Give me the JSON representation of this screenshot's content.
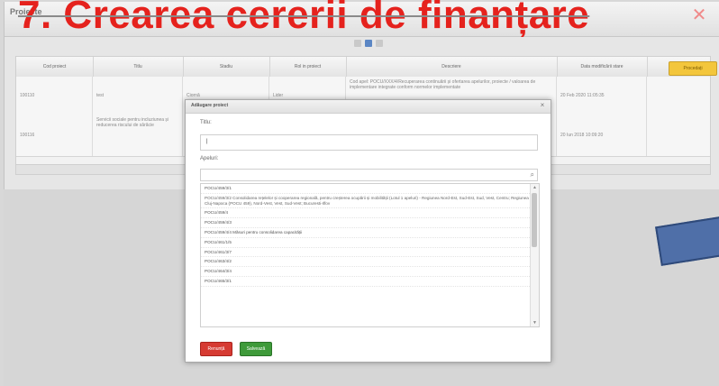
{
  "panel": {
    "title": "Proiecte"
  },
  "slide": {
    "title": "7. Crearea cererii de finanțare"
  },
  "grid": {
    "columns": [
      "Cod proiect",
      "Titlu",
      "Stadiu",
      "Rol in proiect",
      "Descriere",
      "Data modificării stare"
    ],
    "action_label": "Procedați",
    "rows": [
      {
        "code": "100110",
        "title": "test",
        "stage": "Ciornă",
        "role": "Lider",
        "description": "Cod apel: POCU/XXX/4/Recuperarea continuării și ofertarea apelurilor, proiecte / valoarea de implementare integrate conform normelor implementate",
        "date": "20 Feb 2020 11:05:35"
      },
      {
        "code": "100116",
        "title": "Servicii sociale pentru incluziunea și reducerea riscului de sărăcie",
        "stage": "",
        "role": "",
        "description": "",
        "date": "20 Iun 2018 10:09:20"
      }
    ]
  },
  "dialog": {
    "header": "Adăugare proiect",
    "title_label": "Titlu:",
    "title_value": "|",
    "calls_label": "Apeluri:",
    "calls": [
      "POCU/459/3/1",
      "POCU/459/3/2 Consolidarea rețelelor și cooperarea regională, pentru creșterea ocupării și mobilității (Lotul 1 apeluri) - Regiunea Nord-Est, Sud-Est, Sud, Vest, Centru; Regiunea Cluj-Napoca (POCU 459), Nord-Vest, Vest, Sud-Vest; Bucuresti-Ilfov",
      "POCU/459/4",
      "POCU/459/4/3",
      "POCU/459/4/4 Măsuri pentru consolidarea capacității",
      "POCU/461/1/5",
      "POCU/461/3/7",
      "POCU/463/4/2",
      "POCU/464/3/4",
      "POCU/465/3/1"
    ],
    "cancel_label": "Renunță",
    "save_label": "Salvează"
  },
  "colors": {
    "slide_title": "#e5221d",
    "cancel_button": "#d63a32",
    "save_button": "#3e9a3a",
    "action_button": "#f3c63c",
    "blue_shape": "#4f6fa8"
  }
}
